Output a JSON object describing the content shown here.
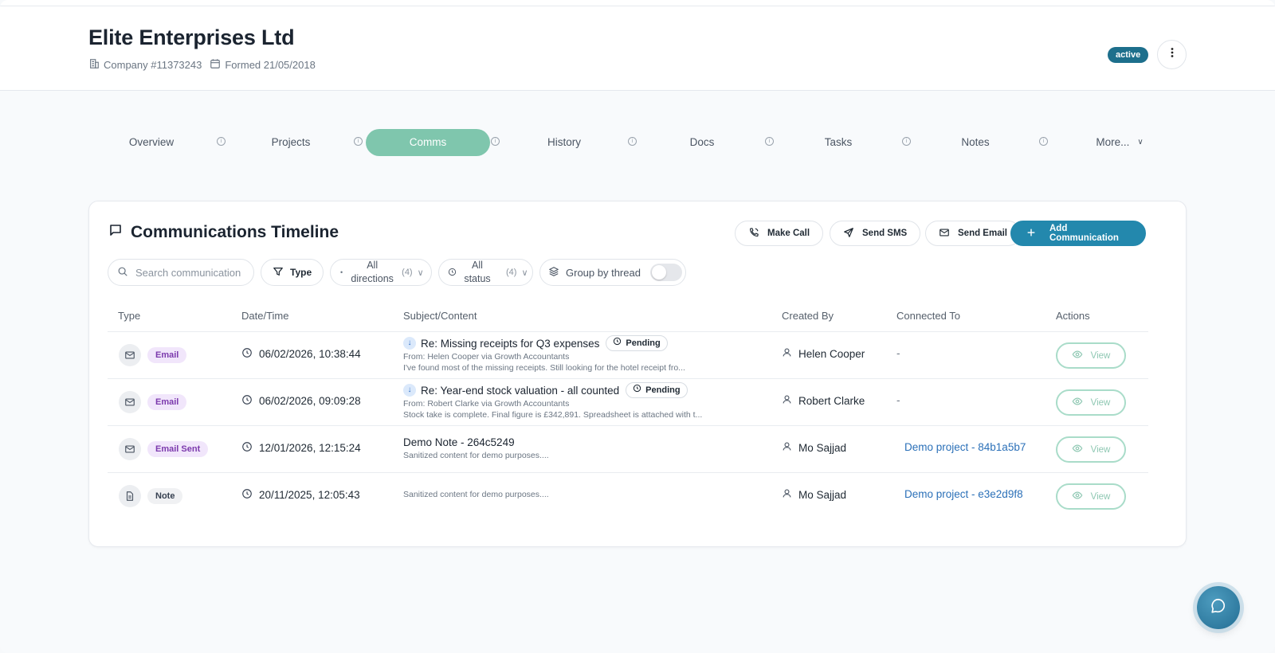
{
  "company": {
    "name": "Elite Enterprises Ltd",
    "number": "Company #11373243",
    "formed": "Formed 21/05/2018",
    "status": "active"
  },
  "tabs": [
    {
      "label": "Overview"
    },
    {
      "label": "Projects"
    },
    {
      "label": "Comms"
    },
    {
      "label": "History"
    },
    {
      "label": "Docs"
    },
    {
      "label": "Tasks"
    },
    {
      "label": "Notes"
    },
    {
      "label": "More..."
    }
  ],
  "active_tab": "Comms",
  "timeline": {
    "title": "Communications Timeline",
    "buttons": {
      "make_call": "Make Call",
      "send_sms": "Send SMS",
      "send_email": "Send Email",
      "add_communication": "Add Communication"
    },
    "filters": {
      "search_placeholder": "Search communication",
      "type_label": "Type",
      "directions_line1": "All",
      "directions_line2": "directions",
      "directions_count": "(4)",
      "status_line1": "All",
      "status_line2": "status",
      "status_count": "(4)",
      "group_by_thread": "Group by thread"
    },
    "columns": [
      "Type",
      "Date/Time",
      "Subject/Content",
      "Created By",
      "Connected To",
      "Actions"
    ],
    "rows": [
      {
        "type": "Email",
        "datetime": "06/02/2026, 10:38:44",
        "subject": "Re: Missing receipts for Q3 expenses",
        "status": "Pending",
        "from": "From: Helen Cooper   via Growth Accountants",
        "preview": "I've found most of the missing receipts. Still looking for the hotel receipt fro...",
        "created_by": "Helen Cooper",
        "connected_to": "-",
        "action": "View"
      },
      {
        "type": "Email",
        "datetime": "06/02/2026, 09:09:28",
        "subject": "Re: Year-end stock valuation - all counted",
        "status": "Pending",
        "from": "From: Robert Clarke   via Growth Accountants",
        "preview": "Stock take is complete. Final figure is £342,891. Spreadsheet is attached with t...",
        "created_by": "Robert Clarke",
        "connected_to": "-",
        "action": "View"
      },
      {
        "type": "Email Sent",
        "datetime": "12/01/2026, 12:15:24",
        "subject": "Demo Note - 264c5249",
        "preview": "Sanitized content for demo purposes....",
        "created_by": "Mo Sajjad",
        "connected_to": "Demo project - 84b1a5b7",
        "action": "View"
      },
      {
        "type": "Note",
        "datetime": "20/11/2025, 12:05:43",
        "preview": "Sanitized content for demo purposes....",
        "created_by": "Mo Sajjad",
        "connected_to": "Demo project - e3e2d9f8",
        "action": "View"
      }
    ]
  },
  "colors": {
    "active_tab": "#7fc6ad",
    "primary_button": "#2388ad",
    "status_badge": "#1d6f8c",
    "email_badge_bg": "#f1e6fb",
    "link": "#2b70b8"
  }
}
